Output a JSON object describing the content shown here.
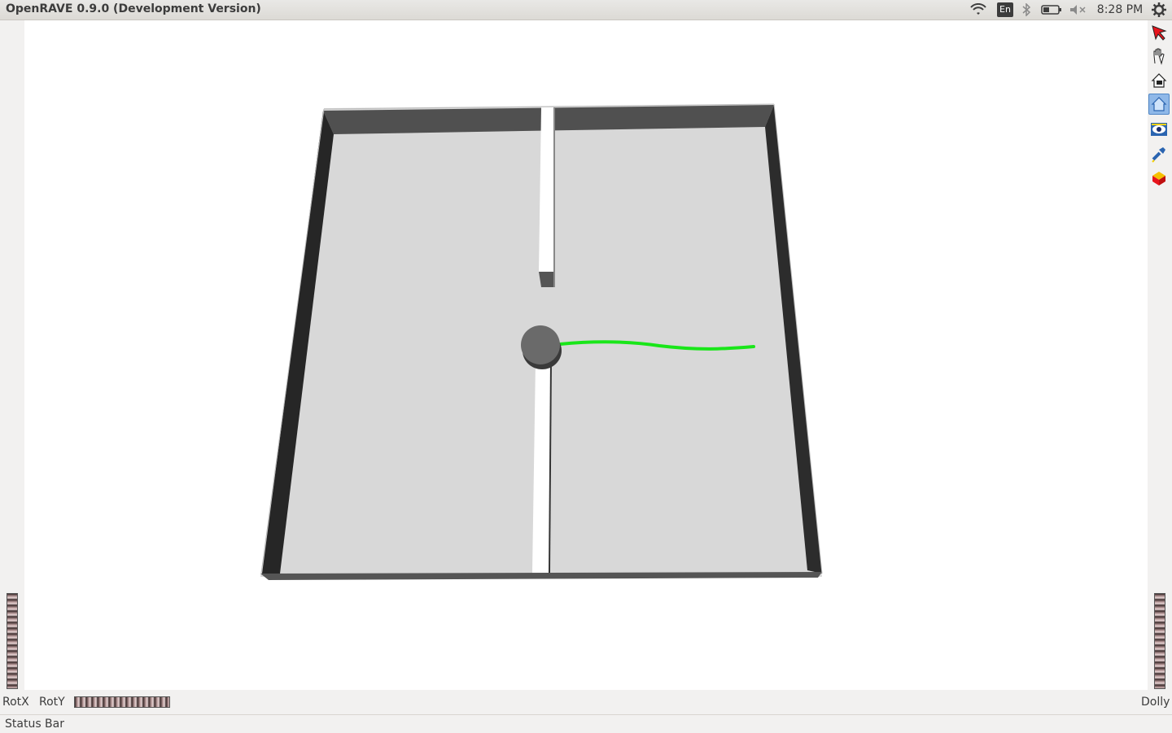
{
  "window": {
    "title": "OpenRAVE 0.9.0 (Development Version)"
  },
  "system_tray": {
    "language": "En",
    "clock": "8:28 PM",
    "icons": [
      "wifi-icon",
      "bluetooth-icon",
      "battery-icon",
      "volume-muted-icon",
      "gear-icon"
    ]
  },
  "toolbar": {
    "tools": [
      {
        "name": "select-arrow-icon"
      },
      {
        "name": "pan-hand-icon"
      },
      {
        "name": "home-icon"
      },
      {
        "name": "set-home-icon",
        "active": true
      },
      {
        "name": "view-all-eye-icon"
      },
      {
        "name": "seek-flashlight-icon"
      },
      {
        "name": "perspective-cube-icon"
      }
    ]
  },
  "wheels": {
    "rotx_label": "RotX",
    "roty_label": "RotY",
    "dolly_label": "Dolly"
  },
  "statusbar": {
    "text": "Status Bar"
  },
  "colors": {
    "floor": "#d8d8d8",
    "wall_dark": "#262626",
    "wall_top": "#505050",
    "robot": "#6a6a6a",
    "trajectory": "#19e619"
  }
}
